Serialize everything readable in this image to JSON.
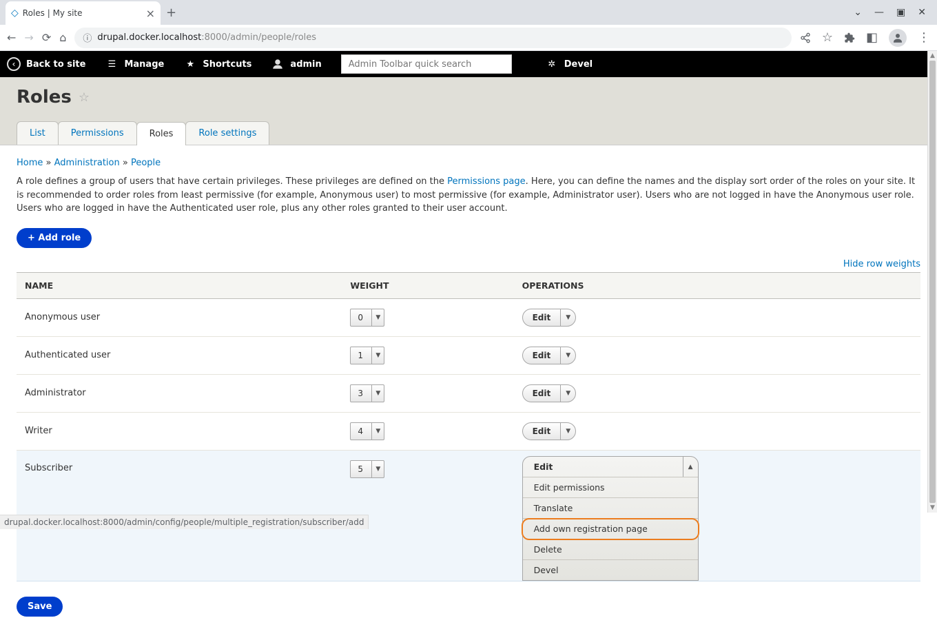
{
  "browser": {
    "tab_title": "Roles | My site",
    "url_host": "drupal.docker.localhost",
    "url_port": ":8000",
    "url_path": "/admin/people/roles",
    "status_url": "drupal.docker.localhost:8000/admin/config/people/multiple_registration/subscriber/add"
  },
  "toolbar": {
    "back_to_site": "Back to site",
    "manage": "Manage",
    "shortcuts": "Shortcuts",
    "admin": "admin",
    "search_placeholder": "Admin Toolbar quick search",
    "devel": "Devel"
  },
  "page": {
    "title": "Roles",
    "tabs": {
      "list": "List",
      "permissions": "Permissions",
      "roles": "Roles",
      "role_settings": "Role settings"
    },
    "breadcrumbs": {
      "home": "Home",
      "admin": "Administration",
      "people": "People"
    },
    "help_1": "A role defines a group of users that have certain privileges. These privileges are defined on the ",
    "help_link": "Permissions page",
    "help_2": ". Here, you can define the names and the display sort order of the roles on your site. It is recommended to order roles from least permissive (for example, Anonymous user) to most permissive (for example, Administrator user). Users who are not logged in have the Anonymous user role. Users who are logged in have the Authenticated user role, plus any other roles granted to their user account.",
    "add_role": "Add role",
    "hide_weights": "Hide row weights",
    "save": "Save"
  },
  "table": {
    "headers": {
      "name": "NAME",
      "weight": "WEIGHT",
      "operations": "OPERATIONS"
    },
    "edit_label": "Edit",
    "rows": [
      {
        "name": "Anonymous user",
        "weight": "0"
      },
      {
        "name": "Authenticated user",
        "weight": "1"
      },
      {
        "name": "Administrator",
        "weight": "3"
      },
      {
        "name": "Writer",
        "weight": "4"
      },
      {
        "name": "Subscriber",
        "weight": "5"
      }
    ]
  },
  "dropdown": {
    "edit": "Edit",
    "edit_permissions": "Edit permissions",
    "translate": "Translate",
    "add_own": "Add own registration page",
    "delete": "Delete",
    "devel": "Devel"
  }
}
